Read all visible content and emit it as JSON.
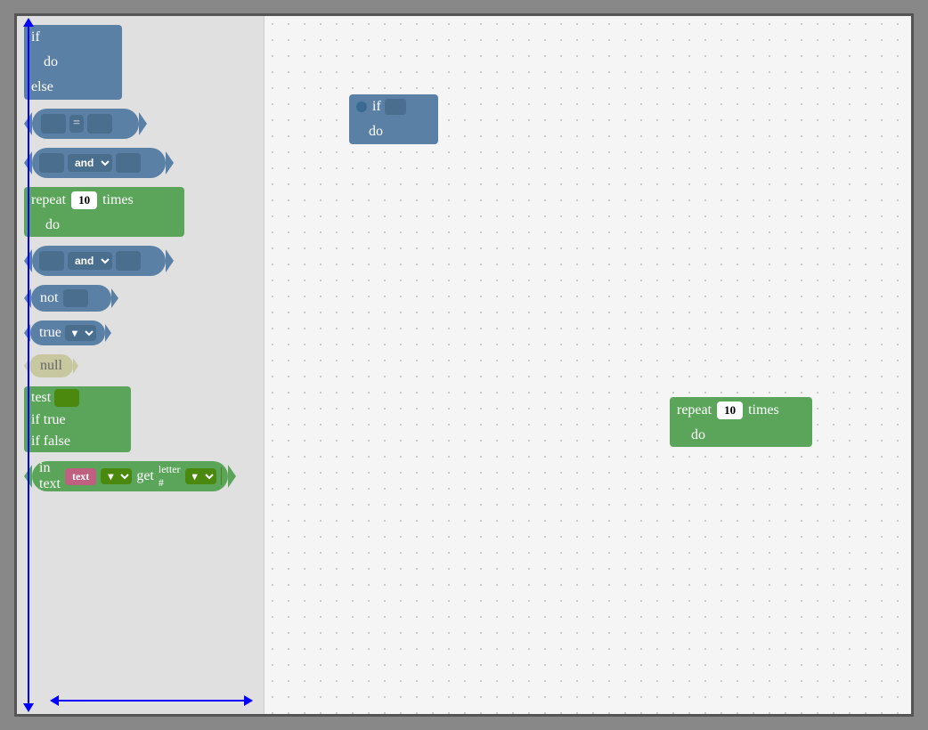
{
  "sidebar": {
    "blocks": [
      {
        "id": "if-else",
        "type": "if-else",
        "labels": {
          "if": "if",
          "do": "do",
          "else": "else"
        }
      },
      {
        "id": "compare",
        "type": "compare",
        "symbol": "="
      },
      {
        "id": "and1",
        "type": "and",
        "label": "and"
      },
      {
        "id": "repeat",
        "type": "repeat",
        "label": "repeat",
        "times": "10",
        "timesLabel": "times",
        "doLabel": "do"
      },
      {
        "id": "and2",
        "type": "and",
        "label": "and"
      },
      {
        "id": "not",
        "type": "not",
        "label": "not"
      },
      {
        "id": "true",
        "type": "true",
        "label": "true"
      },
      {
        "id": "null",
        "type": "null",
        "label": "null"
      },
      {
        "id": "test",
        "type": "test",
        "labels": {
          "test": "test",
          "ifTrue": "if true",
          "ifFalse": "if false"
        }
      },
      {
        "id": "intext",
        "type": "intext",
        "inLabel": "in text",
        "textVal": "text",
        "getLabel": "get",
        "letterLabel": "letter #"
      }
    ]
  },
  "canvas": {
    "ifBlock": {
      "ifLabel": "if",
      "doLabel": "do"
    },
    "repeatBlock": {
      "repeatLabel": "repeat",
      "times": "10",
      "timesLabel": "times",
      "doLabel": "do"
    }
  }
}
